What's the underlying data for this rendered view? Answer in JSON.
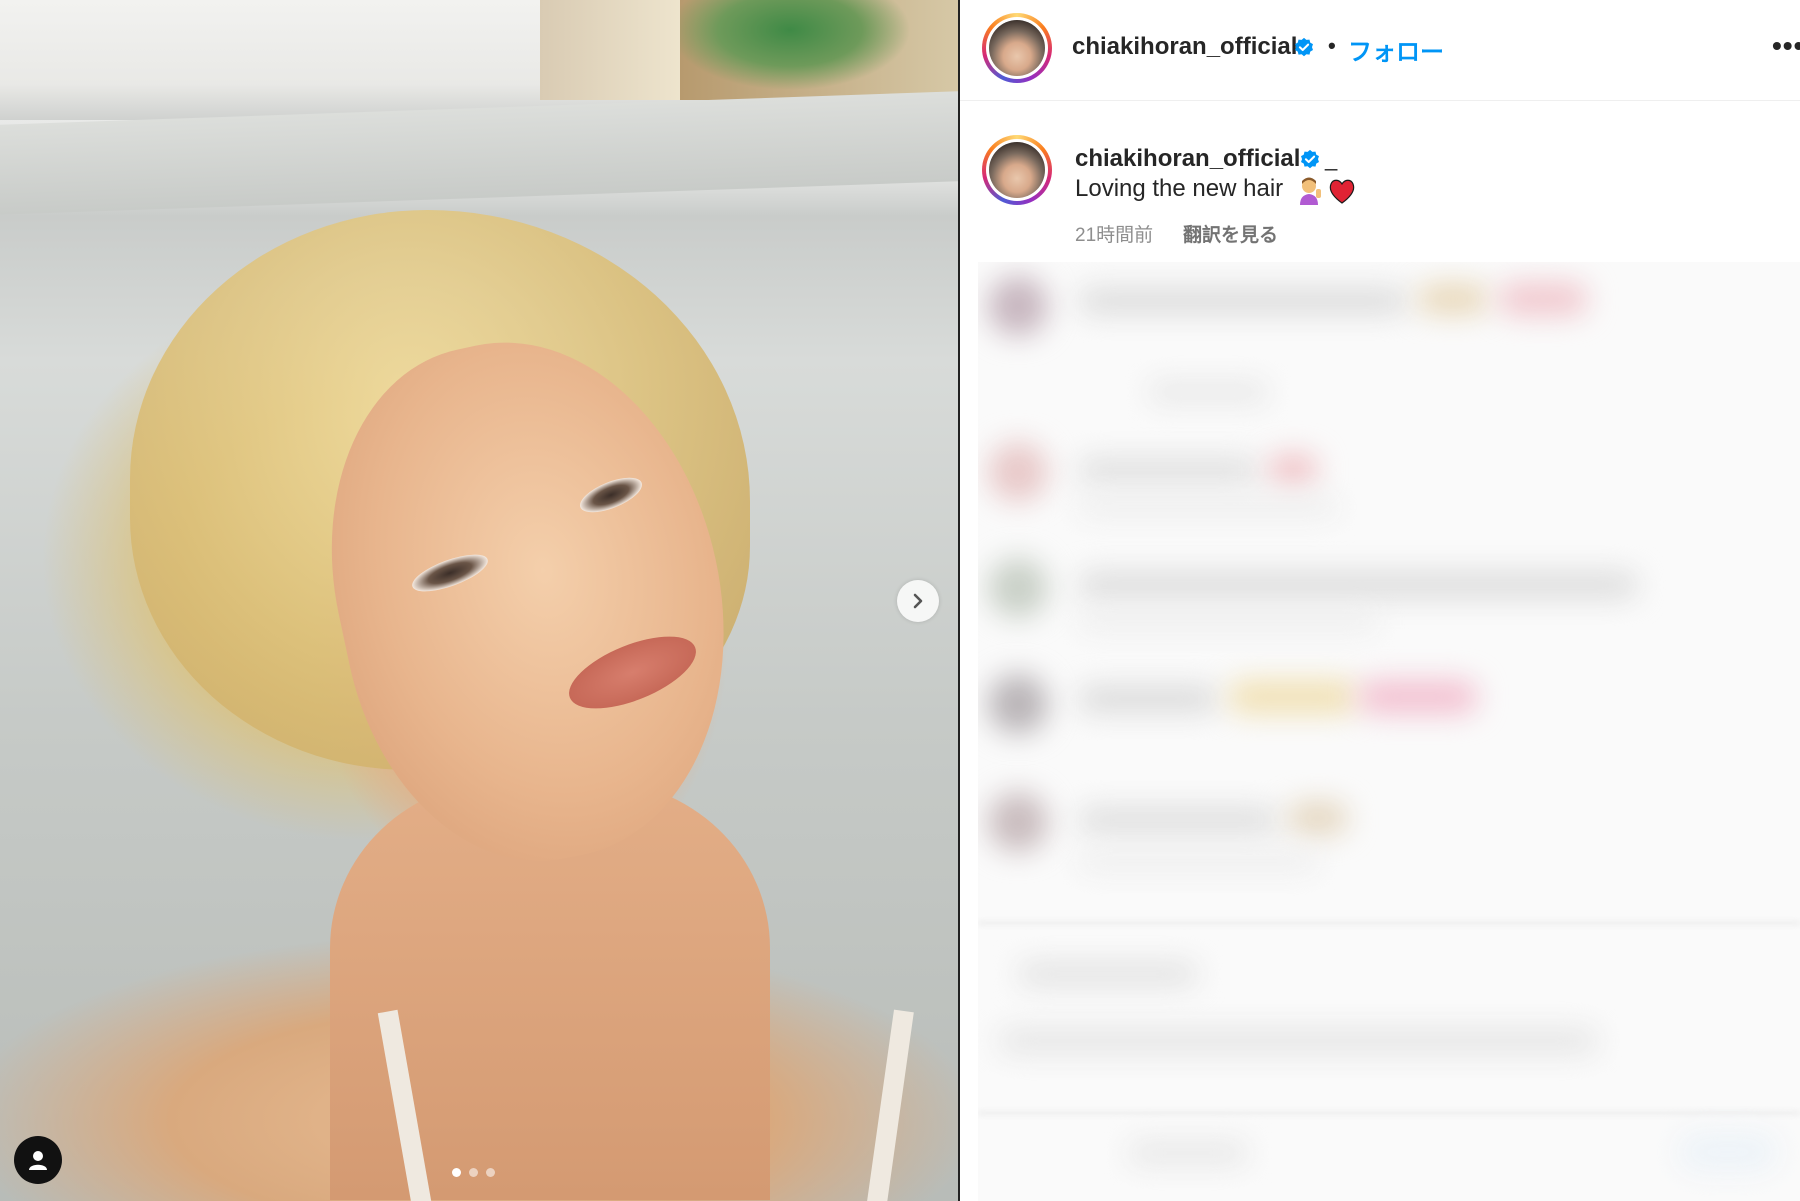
{
  "post": {
    "image_alt_subject": "",
    "carousel": {
      "total_slides": 3,
      "active_index": 0
    }
  },
  "header": {
    "username": "chiakihoran_official",
    "separator": "•",
    "follow_label": "フォロー",
    "more_label": "•••"
  },
  "caption": {
    "username": "chiakihoran_official",
    "suffix": "_",
    "text": "Loving the new hair",
    "emojis": [
      "person-gesturing-icon",
      "red-heart-icon"
    ],
    "time": "21時間前",
    "translate_label": "翻訳を見る"
  },
  "colors": {
    "follow": "#0095f6",
    "verified": "#0095f6",
    "text": "#262626",
    "meta": "#8e8e8e"
  }
}
